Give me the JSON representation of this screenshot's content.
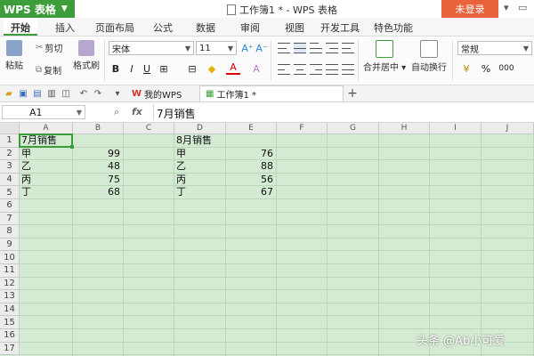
{
  "titlebar": {
    "app_name": "WPS 表格",
    "doc_title": "工作簿1 * - WPS 表格",
    "login_label": "未登录",
    "colors": {
      "app": "#3c9d3a",
      "login": "#e8623b"
    }
  },
  "menu": {
    "items": [
      "开始",
      "插入",
      "页面布局",
      "公式",
      "数据",
      "审阅",
      "视图",
      "开发工具",
      "特色功能"
    ],
    "active": "开始"
  },
  "ribbon": {
    "paste_label": "粘贴",
    "cut_label": "剪切",
    "copy_label": "复制",
    "format_painter_label": "格式刷",
    "font_name": "宋体",
    "font_size": "11",
    "bold": "B",
    "italic": "I",
    "underline": "U",
    "merge_center_label": "合并居中",
    "wrap_text_label": "自动换行",
    "number_format": "常规",
    "percent": "%",
    "thousands": "000"
  },
  "tabs": {
    "mywps_label": "我的WPS",
    "workbook_label": "工作簿1 *",
    "add_label": "+"
  },
  "formula_bar": {
    "cell_ref": "A1",
    "fx": "fx",
    "value": "7月销售"
  },
  "sheet": {
    "columns": [
      "A",
      "B",
      "C",
      "D",
      "E",
      "F",
      "G",
      "H",
      "I",
      "J"
    ],
    "rows": [
      "1",
      "2",
      "3",
      "4",
      "5",
      "6",
      "7",
      "8",
      "9",
      "10",
      "11",
      "12",
      "13",
      "14",
      "15",
      "16",
      "17"
    ],
    "cells": {
      "A1": "7月销售",
      "A2": "甲",
      "B2": "99",
      "A3": "乙",
      "B3": "48",
      "A4": "丙",
      "B4": "75",
      "A5": "丁",
      "B5": "68",
      "D1": "8月销售",
      "D2": "甲",
      "E2": "76",
      "D3": "乙",
      "E3": "88",
      "D4": "丙",
      "E4": "56",
      "D5": "丁",
      "E5": "67"
    },
    "selected_cell": "A1"
  },
  "watermark": "头条 @Ab小可爱"
}
